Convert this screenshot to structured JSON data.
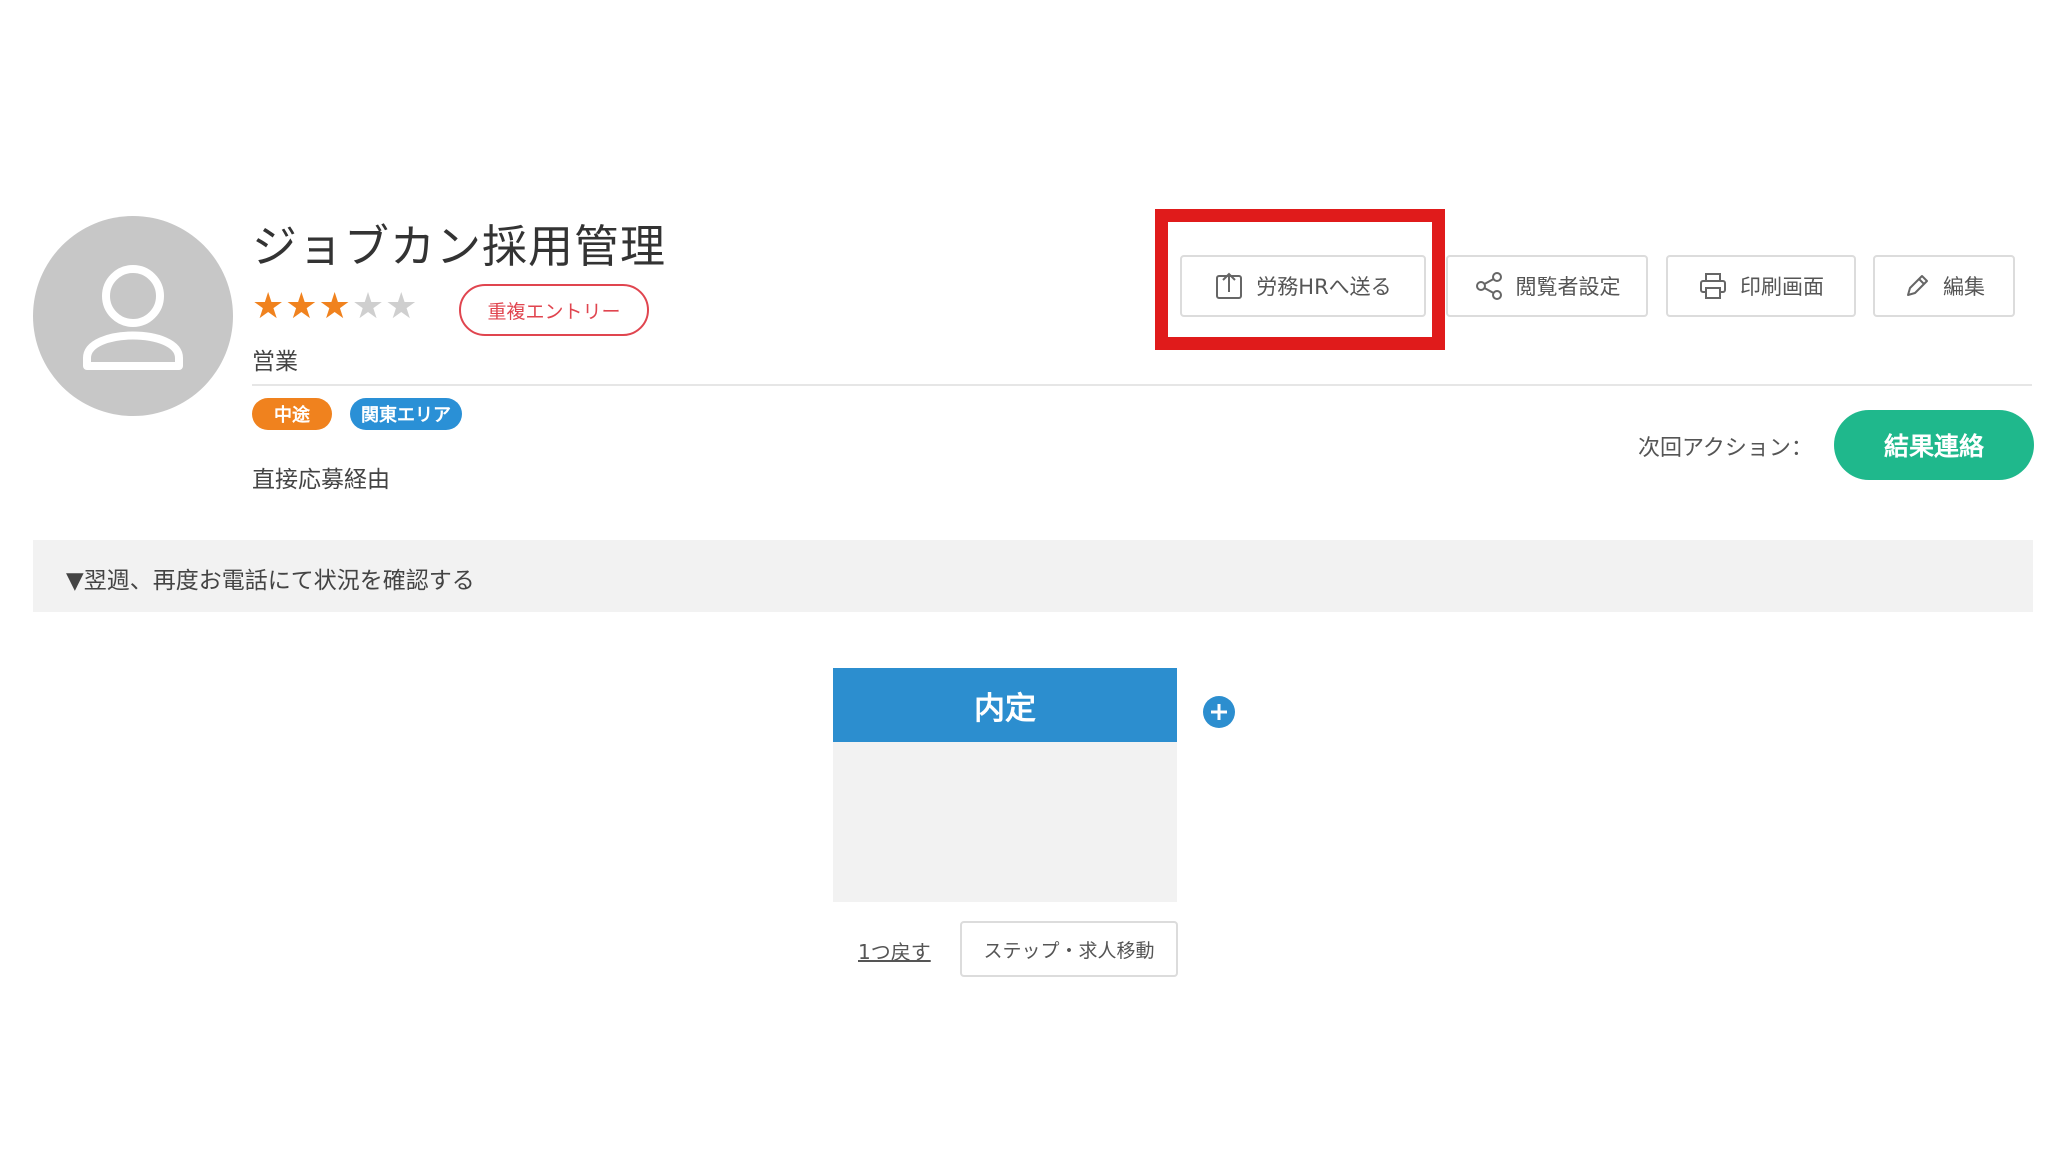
{
  "profile": {
    "name": "ジョブカン採用管理",
    "rating": 3,
    "rating_max": 5,
    "stars_filled": "★★★",
    "stars_empty": "★★",
    "duplicate_badge": "重複エントリー",
    "department": "営業",
    "tags": [
      "中途",
      "関東エリア"
    ],
    "source": "直接応募経由"
  },
  "toolbar": {
    "send_label": "労務HRへ送る",
    "viewer_label": "閲覧者設定",
    "print_label": "印刷画面",
    "edit_label": "編集"
  },
  "next_action": {
    "label": "次回アクション：",
    "button": "結果連絡"
  },
  "memo": "▼翌週、再度お電話にて状況を確認する",
  "stage": {
    "title": "内定",
    "undo_label": "1つ戻す",
    "move_label": "ステップ・求人移動"
  },
  "colors": {
    "accent_blue": "#2c8ecf",
    "success_green": "#1fb88c",
    "tag_orange": "#f0821e",
    "highlight_red": "#e01b1b",
    "badge_red": "#e0454f"
  },
  "icons": {
    "avatar": "user-silhouette-icon",
    "send": "upload-icon",
    "viewer": "share-icon",
    "print": "printer-icon",
    "edit": "pencil-icon",
    "add": "plus-circle-icon"
  }
}
